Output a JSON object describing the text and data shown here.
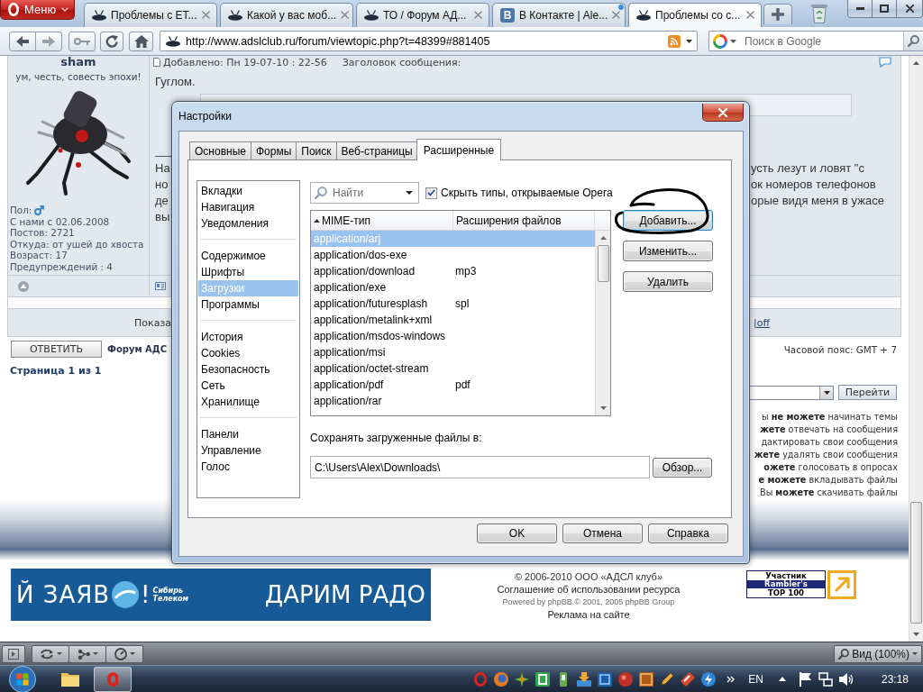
{
  "browser": {
    "menu_label": "Меню",
    "tabs": [
      {
        "title": "Проблемы с ЕТ...",
        "kind": "saucer",
        "selected": false,
        "updated": false
      },
      {
        "title": "Какой у вас моб...",
        "kind": "saucer",
        "selected": false,
        "updated": false
      },
      {
        "title": "ТО / Форум АД...",
        "kind": "saucer",
        "selected": false,
        "updated": false
      },
      {
        "title": "В Контакте | Ale...",
        "kind": "letter",
        "icon_text": "В",
        "selected": false,
        "updated": true
      },
      {
        "title": "Проблемы со с...",
        "kind": "saucer",
        "selected": true,
        "updated": false
      }
    ],
    "address": {
      "url": "http://www.adslclub.ru/forum/viewtopic.php?t=48399#881405"
    },
    "search": {
      "placeholder": "Поиск в Google"
    }
  },
  "post": {
    "author": {
      "name": "sham",
      "rank": "ум, честь, совесть эпохи!",
      "gender_label": "Пол:",
      "details": [
        "С нами с 02.06.2008",
        "Постов: 2721",
        "Откуда: от ушей до хвоста",
        "Возраст: 17",
        "Предупреждений : 4"
      ]
    },
    "meta": {
      "posted": "Добавлено: Пн 19-07-10 : 22-56",
      "subject_label": "Заголовок сообщения:"
    },
    "first_line": "Гуглом.",
    "lines": [
      {
        "left": "На",
        "right": "усть лезут и ловят \"с"
      },
      {
        "left": "но",
        "right": "ок номеров телефонов"
      },
      {
        "left": "де",
        "right": "орые видя меня в ужасе"
      },
      {
        "left": "вы"
      }
    ]
  },
  "topic": {
    "view_fragment": "Показа",
    "toggle_link": "|off",
    "reply_button": "ОТВЕТИТЬ",
    "breadcrumb": "Форум АДС",
    "timezone": "Часовой пояс: GMT + 7",
    "pagination": "Страница 1 из 1",
    "jump_button": "Перейти",
    "permissions": [
      "ы **не можете** начинать темы",
      "**жете** отвечать на сообщения",
      "дактировать свои сообщения",
      "**жете** удалять свои сообщения",
      "**ожете** голосовать в опросах",
      "**е можете** вкладывать файлы",
      "Вы **можете** скачивать файлы"
    ]
  },
  "footer": {
    "banner": {
      "left_text": "Й ЗАЯВ",
      "end_mark": "!",
      "logo_lines": [
        "Сибирь",
        "Телеком"
      ],
      "right_text": "ДАРИМ РАДО"
    },
    "lines": [
      {
        "text": "© 2006-2010 ООО «АДСЛ клуб»",
        "kind": "text"
      },
      {
        "text": "Соглашение об использовании ресурса",
        "kind": "link"
      },
      {
        "text": "Powered by phpBB © 2001, 2005 phpBB Group",
        "kind": "small"
      },
      {
        "text": "Реклама на сайте",
        "kind": "link"
      }
    ],
    "counter": [
      {
        "text": "Участник",
        "kind": "plain"
      },
      {
        "text": "Rambler's",
        "kind": "inverted"
      },
      {
        "text": "TOP 100",
        "kind": "plain"
      }
    ]
  },
  "status_bar": {
    "zoom_label": "Вид (100%)"
  },
  "taskbar": {
    "language": "EN",
    "clock": "23:18"
  },
  "dialog": {
    "title": "Настройки",
    "tabs": [
      {
        "label": "Основные",
        "selected": false
      },
      {
        "label": "Формы",
        "selected": false
      },
      {
        "label": "Поиск",
        "selected": false
      },
      {
        "label": "Веб-страницы",
        "selected": false
      },
      {
        "label": "Расширенные",
        "selected": true
      }
    ],
    "sections": [
      {
        "items": [
          {
            "label": "Вкладки",
            "selected": false
          },
          {
            "label": "Навигация",
            "selected": false
          },
          {
            "label": "Уведомления",
            "selected": false
          }
        ]
      },
      {
        "items": [
          {
            "label": "Содержимое",
            "selected": false
          },
          {
            "label": "Шрифты",
            "selected": false
          },
          {
            "label": "Загрузки",
            "selected": true
          },
          {
            "label": "Программы",
            "selected": false
          }
        ]
      },
      {
        "items": [
          {
            "label": "История",
            "selected": false
          },
          {
            "label": "Cookies",
            "selected": false
          },
          {
            "label": "Безопасность",
            "selected": false
          },
          {
            "label": "Сеть",
            "selected": false
          },
          {
            "label": "Хранилище",
            "selected": false
          }
        ]
      },
      {
        "items": [
          {
            "label": "Панели",
            "selected": false
          },
          {
            "label": "Управление",
            "selected": false
          },
          {
            "label": "Голос",
            "selected": false
          }
        ]
      }
    ],
    "filter": {
      "placeholder": "Найти"
    },
    "hide_types": {
      "label": "Скрыть типы, открываемые Opera",
      "checked": true
    },
    "table": {
      "columns": [
        {
          "label": "MIME-тип",
          "sorted": true
        },
        {
          "label": "Расширения файлов",
          "sorted": false
        }
      ],
      "rows": [
        {
          "mime": "application/arj",
          "selected": true
        },
        {
          "mime": "application/dos-exe",
          "selected": false
        },
        {
          "mime": "application/download",
          "ext": "mp3",
          "selected": false
        },
        {
          "mime": "application/exe",
          "selected": false
        },
        {
          "mime": "application/futuresplash",
          "ext": "spl",
          "selected": false
        },
        {
          "mime": "application/metalink+xml",
          "selected": false
        },
        {
          "mime": "application/msdos-windows",
          "selected": false
        },
        {
          "mime": "application/msi",
          "selected": false
        },
        {
          "mime": "application/octet-stream",
          "selected": false
        },
        {
          "mime": "application/pdf",
          "ext": "pdf",
          "selected": false
        },
        {
          "mime": "application/rar",
          "selected": false
        }
      ]
    },
    "actions": [
      {
        "label": "Добавить...",
        "default": true,
        "circled": true
      },
      {
        "label": "Изменить...",
        "default": false,
        "circled": false
      },
      {
        "label": "Удалить",
        "default": false,
        "circled": false
      }
    ],
    "save_label": "Сохранять загруженные файлы в:",
    "save_path": {
      "value": "C:\\Users\\Alex\\Downloads\\"
    },
    "browse_button": "Обзор...",
    "buttons": [
      "OK",
      "Отмена",
      "Справка"
    ]
  }
}
